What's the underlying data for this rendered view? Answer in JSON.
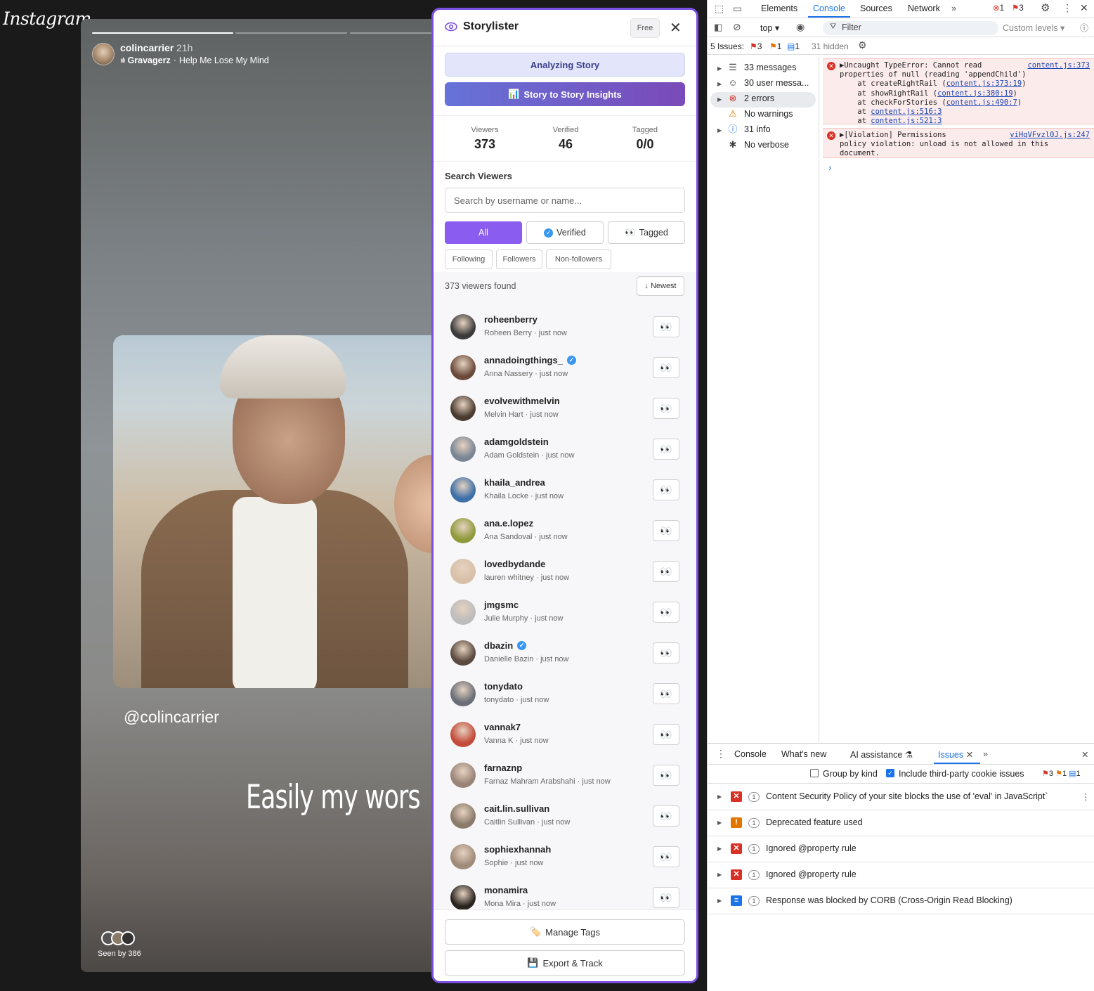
{
  "instagram": {
    "logo": "Instagram",
    "story": {
      "username": "colincarrier",
      "time": "21h",
      "music_artist": "Gravagerz",
      "music_sep": "·",
      "music_track": "Help Me Lose My Mind",
      "handle": "@colincarrier",
      "caption": "Easily my wors",
      "seen_by": "Seen by 386",
      "progress": [
        1,
        0,
        0
      ]
    }
  },
  "storylister": {
    "title": "Storylister",
    "plan": "Free",
    "analyze_label": "Analyzing Story",
    "insights_label": "Story to Story Insights",
    "stats": [
      {
        "label": "Viewers",
        "value": "373"
      },
      {
        "label": "Verified",
        "value": "46"
      },
      {
        "label": "Tagged",
        "value": "0/0"
      }
    ],
    "search_label": "Search Viewers",
    "search_placeholder": "Search by username or name...",
    "filters": [
      "All",
      "Verified",
      "Tagged"
    ],
    "filters2": [
      "Following",
      "Followers",
      "Non-followers"
    ],
    "found_text": "373 viewers found",
    "sort_label": "Newest",
    "viewers": [
      {
        "username": "roheenberry",
        "sub": "Roheen Berry · just now",
        "verified": false,
        "color": "#3a3a3a"
      },
      {
        "username": "annadoingthings_",
        "sub": "Anna Nassery · just now",
        "verified": true,
        "color": "#6b4a3a"
      },
      {
        "username": "evolvewithmelvin",
        "sub": "Melvin Hart · just now",
        "verified": false,
        "color": "#4a3b30"
      },
      {
        "username": "adamgoldstein",
        "sub": "Adam Goldstein · just now",
        "verified": false,
        "color": "#7a8594"
      },
      {
        "username": "khaila_andrea",
        "sub": "Khaila Locke · just now",
        "verified": false,
        "color": "#3d6fa8"
      },
      {
        "username": "ana.e.lopez",
        "sub": "Ana Sandoval · just now",
        "verified": false,
        "color": "#8f9a3c"
      },
      {
        "username": "lovedbydande",
        "sub": "lauren whitney · just now",
        "verified": false,
        "color": "#d8c0a8"
      },
      {
        "username": "jmgsmc",
        "sub": "Julie Murphy · just now",
        "verified": false,
        "color": "#bdbdbd"
      },
      {
        "username": "dbazin",
        "sub": "Danielle Bazin · just now",
        "verified": true,
        "color": "#5a4a3f"
      },
      {
        "username": "tonydato",
        "sub": "tonydato · just now",
        "verified": false,
        "color": "#6a6e78"
      },
      {
        "username": "vannak7",
        "sub": "Vanna K · just now",
        "verified": false,
        "color": "#c44a3a"
      },
      {
        "username": "farnaznp",
        "sub": "Farnaz Mahram Arabshahi · just now",
        "verified": false,
        "color": "#9a8478"
      },
      {
        "username": "cait.lin.sullivan",
        "sub": "Caitlin Sullivan · just now",
        "verified": false,
        "color": "#8a7a6a"
      },
      {
        "username": "sophiexhannah",
        "sub": "Sophie · just now",
        "verified": false,
        "color": "#a08a7a"
      },
      {
        "username": "monamira",
        "sub": "Mona Mira · just now",
        "verified": false,
        "color": "#2a2420"
      }
    ],
    "manage_tags_label": "Manage Tags",
    "export_label": "Export & Track"
  },
  "devtools": {
    "tabs": [
      "Elements",
      "Console",
      "Sources",
      "Network"
    ],
    "active_tab": "Console",
    "error_count": "1",
    "issue_count": "3",
    "context": "top",
    "filter_placeholder": "Filter",
    "levels": "Custom levels",
    "issues_bar": {
      "label": "5 Issues:",
      "red": "3",
      "orange": "1",
      "blue": "1",
      "hidden": "31 hidden"
    },
    "sidebar": [
      {
        "label": "33 messages",
        "icon": "list-icon"
      },
      {
        "label": "30 user messa...",
        "icon": "user-icon"
      },
      {
        "label": "2 errors",
        "icon": "error-icon"
      },
      {
        "label": "No warnings",
        "icon": "warning-icon"
      },
      {
        "label": "31 info",
        "icon": "info-icon"
      },
      {
        "label": "No verbose",
        "icon": "bug-icon"
      }
    ],
    "errors": [
      {
        "lines": [
          "Uncaught TypeError: Cannot read",
          "properties of null (reading 'appendChild')"
        ],
        "file": "content.js:373",
        "stack": [
          {
            "prefix": "    at createRightRail (",
            "link": "content.js:373:19",
            "suffix": ")"
          },
          {
            "prefix": "    at showRightRail (",
            "link": "content.js:380:19",
            "suffix": ")"
          },
          {
            "prefix": "    at checkForStories (",
            "link": "content.js:490:7",
            "suffix": ")"
          },
          {
            "prefix": "    at ",
            "link": "content.js:516:3",
            "suffix": ""
          },
          {
            "prefix": "    at ",
            "link": "content.js:521:3",
            "suffix": ""
          }
        ]
      },
      {
        "lines": [
          "[Violation] Permissions",
          "policy violation: unload is not allowed in this",
          "document."
        ],
        "file": "viHqVFvzl0J.js:247",
        "stack": []
      }
    ],
    "drawer": {
      "tabs": [
        "Console",
        "What's new",
        "AI assistance",
        "Issues"
      ],
      "group_by_kind": "Group by kind",
      "include_third_party": "Include third-party cookie issues",
      "counts": {
        "red": "3",
        "orange": "1",
        "blue": "1"
      },
      "issues": [
        {
          "type": "red",
          "count": "1",
          "text": "Content Security Policy of your site blocks the use of 'eval' in JavaScript`"
        },
        {
          "type": "orange",
          "count": "1",
          "text": "Deprecated feature used"
        },
        {
          "type": "red",
          "count": "1",
          "text": "Ignored @property rule"
        },
        {
          "type": "red",
          "count": "1",
          "text": "Ignored @property rule"
        },
        {
          "type": "blue",
          "count": "1",
          "text": "Response was blocked by CORB (Cross-Origin Read Blocking)"
        }
      ]
    }
  }
}
